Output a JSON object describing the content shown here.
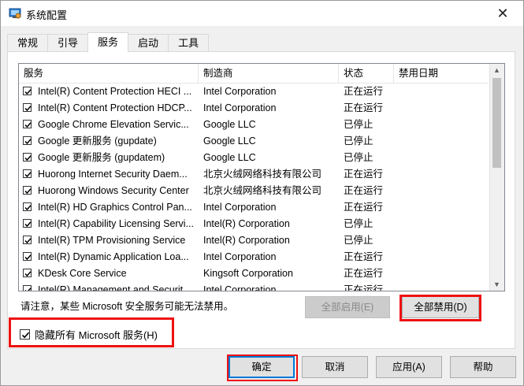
{
  "window": {
    "title": "系统配置",
    "close_label": "✕"
  },
  "tabs": [
    {
      "label": "常规"
    },
    {
      "label": "引导"
    },
    {
      "label": "服务",
      "active": true
    },
    {
      "label": "启动"
    },
    {
      "label": "工具"
    }
  ],
  "table": {
    "columns": [
      "服务",
      "制造商",
      "状态",
      "禁用日期"
    ],
    "rows": [
      {
        "name": "Intel(R) Content Protection HECI ...",
        "vendor": "Intel Corporation",
        "status": "正在运行",
        "date": ""
      },
      {
        "name": "Intel(R) Content Protection HDCP...",
        "vendor": "Intel Corporation",
        "status": "正在运行",
        "date": ""
      },
      {
        "name": "Google Chrome Elevation Servic...",
        "vendor": "Google LLC",
        "status": "已停止",
        "date": ""
      },
      {
        "name": "Google 更新服务 (gupdate)",
        "vendor": "Google LLC",
        "status": "已停止",
        "date": ""
      },
      {
        "name": "Google 更新服务 (gupdatem)",
        "vendor": "Google LLC",
        "status": "已停止",
        "date": ""
      },
      {
        "name": "Huorong Internet Security Daem...",
        "vendor": "北京火绒网络科技有限公司",
        "status": "正在运行",
        "date": ""
      },
      {
        "name": "Huorong Windows Security Center",
        "vendor": "北京火绒网络科技有限公司",
        "status": "正在运行",
        "date": ""
      },
      {
        "name": "Intel(R) HD Graphics Control Pan...",
        "vendor": "Intel Corporation",
        "status": "正在运行",
        "date": ""
      },
      {
        "name": "Intel(R) Capability Licensing Servi...",
        "vendor": "Intel(R) Corporation",
        "status": "已停止",
        "date": ""
      },
      {
        "name": "Intel(R) TPM Provisioning Service",
        "vendor": "Intel(R) Corporation",
        "status": "已停止",
        "date": ""
      },
      {
        "name": "Intel(R) Dynamic Application Loa...",
        "vendor": "Intel Corporation",
        "status": "正在运行",
        "date": ""
      },
      {
        "name": "KDesk Core Service",
        "vendor": "Kingsoft Corporation",
        "status": "正在运行",
        "date": ""
      },
      {
        "name": "Intel(R) Management and Securit...",
        "vendor": "Intel Corporation",
        "status": "正在运行",
        "date": ""
      }
    ]
  },
  "notice": "请注意，某些 Microsoft 安全服务可能无法禁用。",
  "buttons": {
    "enable_all": "全部启用(E)",
    "disable_all": "全部禁用(D)",
    "ok": "确定",
    "cancel": "取消",
    "apply": "应用(A)",
    "help": "帮助"
  },
  "hide_ms": {
    "label": "隐藏所有 Microsoft 服务(H)",
    "checked": true
  },
  "colors": {
    "highlight": "#e11111",
    "accent": "#0078d7"
  }
}
